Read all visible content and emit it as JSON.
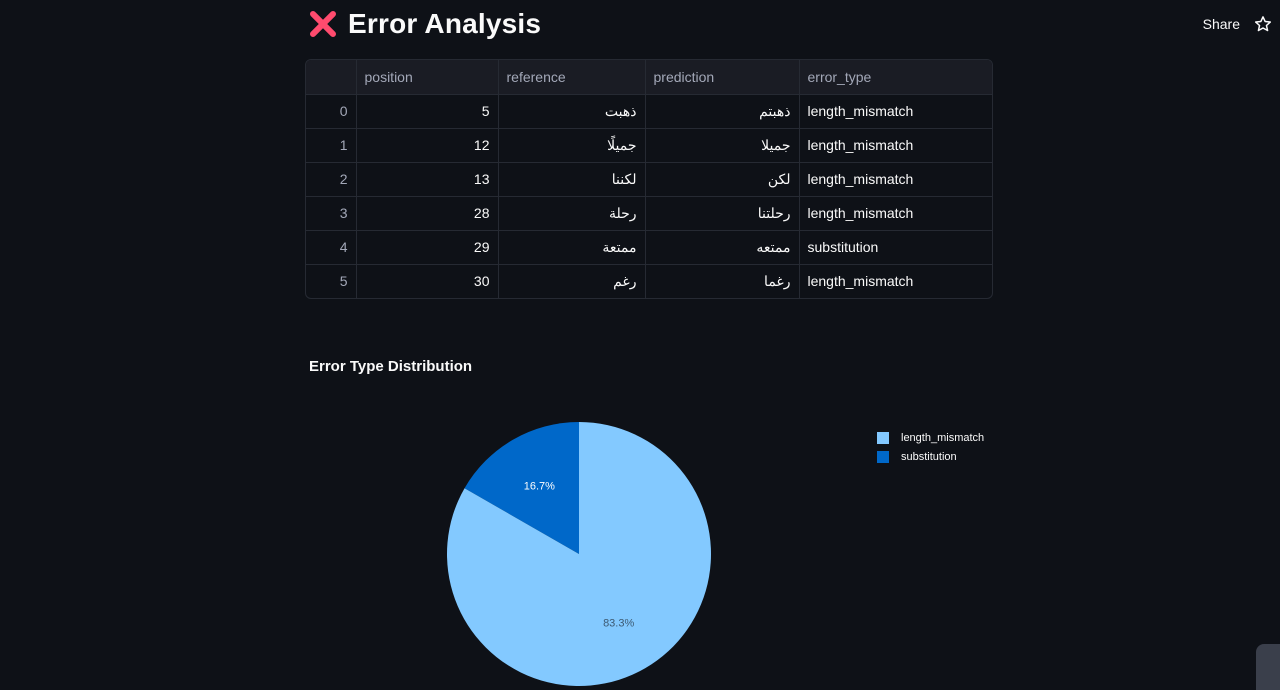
{
  "header": {
    "share_label": "Share"
  },
  "page": {
    "title": "Error Analysis",
    "title_icon": "cross-mark-icon"
  },
  "table": {
    "columns": [
      "",
      "position",
      "reference",
      "prediction",
      "error_type"
    ],
    "rows": [
      {
        "index": "0",
        "position": "5",
        "reference": "ذهبت",
        "prediction": "ذهبتم",
        "error_type": "length_mismatch"
      },
      {
        "index": "1",
        "position": "12",
        "reference": "جميلًا",
        "prediction": "جميلا",
        "error_type": "length_mismatch"
      },
      {
        "index": "2",
        "position": "13",
        "reference": "لكننا",
        "prediction": "لكن",
        "error_type": "length_mismatch"
      },
      {
        "index": "3",
        "position": "28",
        "reference": "رحلة",
        "prediction": "رحلتنا",
        "error_type": "length_mismatch"
      },
      {
        "index": "4",
        "position": "29",
        "reference": "ممتعة",
        "prediction": "ممتعه",
        "error_type": "substitution"
      },
      {
        "index": "5",
        "position": "30",
        "reference": "رغم",
        "prediction": "رغما",
        "error_type": "length_mismatch"
      }
    ]
  },
  "chart_title": "Error Type Distribution",
  "chart_data": {
    "type": "pie",
    "slices": [
      {
        "name": "length_mismatch",
        "value": 83.3,
        "label": "83.3%",
        "color": "#83c9ff"
      },
      {
        "name": "substitution",
        "value": 16.7,
        "label": "16.7%",
        "color": "#0068c9"
      }
    ],
    "legend": "top-right"
  },
  "colors": {
    "background": "#0e1117",
    "accent_red": "#ff4b6e"
  }
}
